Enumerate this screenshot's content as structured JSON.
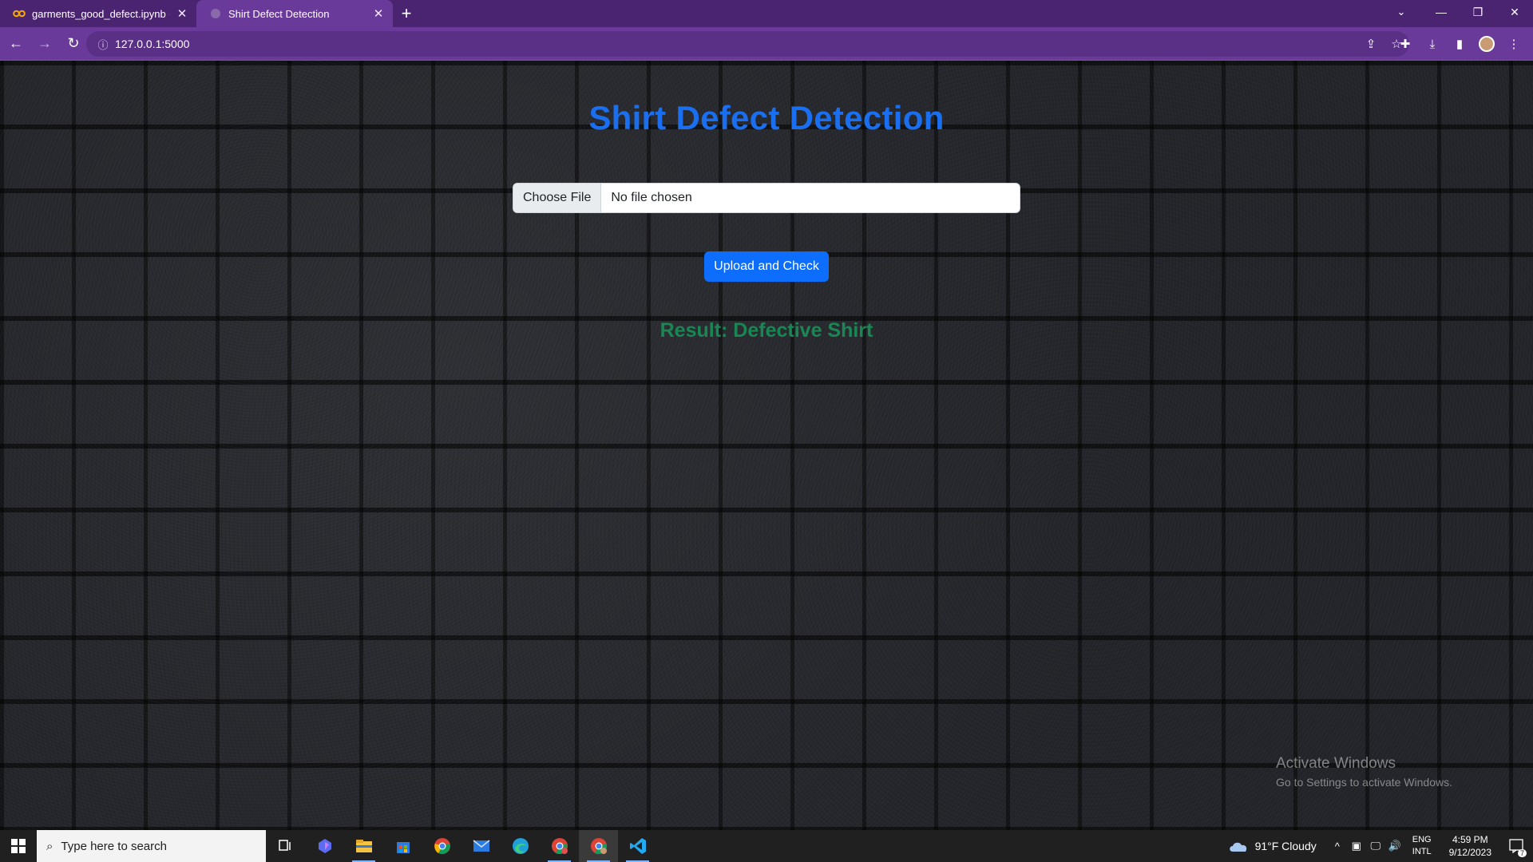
{
  "browser": {
    "tabs": [
      {
        "title": "garments_good_defect.ipynb - Co",
        "icon": "colab-icon",
        "active": false
      },
      {
        "title": "Shirt Defect Detection",
        "icon": "globe-icon",
        "active": true
      }
    ],
    "url": "127.0.0.1:5000"
  },
  "page": {
    "title": "Shirt Defect Detection",
    "file_button": "Choose File",
    "file_status": "No file chosen",
    "submit_label": "Upload and Check",
    "result": "Result: Defective Shirt"
  },
  "watermark": {
    "title": "Activate Windows",
    "subtitle": "Go to Settings to activate Windows."
  },
  "taskbar": {
    "search_placeholder": "Type here to search",
    "apps": [
      "task-view",
      "copilot",
      "file-explorer",
      "microsoft-store",
      "chrome",
      "mail",
      "edge",
      "chrome-profile-1",
      "chrome-profile-2",
      "vscode"
    ],
    "weather": "91°F  Cloudy",
    "lang_top": "ENG",
    "lang_bottom": "INTL",
    "time": "4:59 PM",
    "date": "9/12/2023",
    "notification_count": "7"
  }
}
